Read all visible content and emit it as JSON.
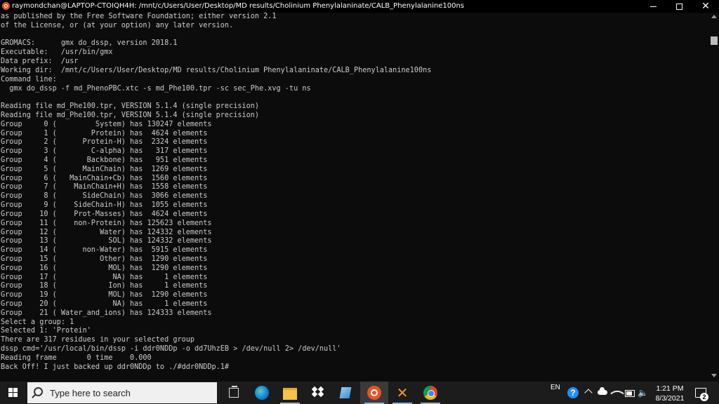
{
  "window": {
    "title": "raymondchan@LAPTOP-CTOIQH4H: /mnt/c/Users/User/Desktop/MD results/Cholinium Phenylalaninate/CALB_Phenylalanine100ns",
    "controls": {
      "minimize": "minimize",
      "maximize": "restore",
      "close": "close"
    }
  },
  "terminal": {
    "lines": [
      "as published by the Free Software Foundation; either version 2.1",
      "of the License, or (at your option) any later version.",
      "",
      "GROMACS:      gmx do_dssp, version 2018.1",
      "Executable:   /usr/bin/gmx",
      "Data prefix:  /usr",
      "Working dir:  /mnt/c/Users/User/Desktop/MD results/Cholinium Phenylalaninate/CALB_Phenylalanine100ns",
      "Command line:",
      "  gmx do_dssp -f md_PhenoPBC.xtc -s md_Phe100.tpr -sc sec_Phe.xvg -tu ns",
      "",
      "Reading file md_Phe100.tpr, VERSION 5.1.4 (single precision)",
      "Reading file md_Phe100.tpr, VERSION 5.1.4 (single precision)",
      "Group     0 (         System) has 130247 elements",
      "Group     1 (        Protein) has  4624 elements",
      "Group     2 (      Protein-H) has  2324 elements",
      "Group     3 (        C-alpha) has   317 elements",
      "Group     4 (       Backbone) has   951 elements",
      "Group     5 (      MainChain) has  1269 elements",
      "Group     6 (   MainChain+Cb) has  1560 elements",
      "Group     7 (    MainChain+H) has  1558 elements",
      "Group     8 (      SideChain) has  3066 elements",
      "Group     9 (    SideChain-H) has  1055 elements",
      "Group    10 (    Prot-Masses) has  4624 elements",
      "Group    11 (    non-Protein) has 125623 elements",
      "Group    12 (          Water) has 124332 elements",
      "Group    13 (            SOL) has 124332 elements",
      "Group    14 (      non-Water) has  5915 elements",
      "Group    15 (          Other) has  1290 elements",
      "Group    16 (            MOL) has  1290 elements",
      "Group    17 (             NA) has     1 elements",
      "Group    18 (            Ion) has     1 elements",
      "Group    19 (            MOL) has  1290 elements",
      "Group    20 (             NA) has     1 elements",
      "Group    21 ( Water_and_ions) has 124333 elements",
      "Select a group: 1",
      "Selected 1: 'Protein'",
      "There are 317 residues in your selected group",
      "dssp cmd='/usr/local/bin/dssp -i ddr0NDDp -o dd7UhzEB > /dev/null 2> /dev/null'",
      "Reading frame       0 time    0.000",
      "Back Off! I just backed up ddr0NDDp to ./#ddr0NDDp.1#"
    ]
  },
  "taskbar": {
    "search_placeholder": "Type here to search",
    "language": "EN",
    "time": "1:21 PM",
    "date": "8/3/2021",
    "notification_count": "2",
    "apps": [
      "task-view",
      "edge",
      "file-explorer",
      "dropbox",
      "notepad",
      "ubuntu",
      "xming",
      "chrome"
    ]
  },
  "colors": {
    "terminal_bg": "#0c0c0c",
    "terminal_fg": "#cccccc",
    "taskbar_bg": "#1c1c1c",
    "ubuntu_orange": "#e95420"
  }
}
